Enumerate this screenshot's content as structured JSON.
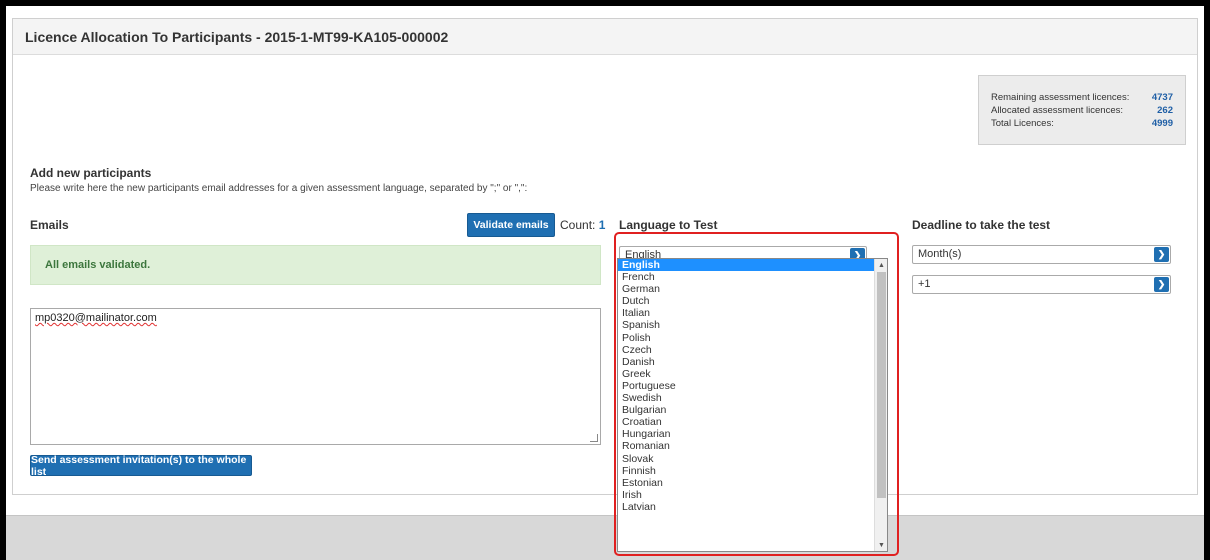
{
  "panel": {
    "title": "Licence Allocation To Participants - 2015-1-MT99-KA105-000002"
  },
  "stats": [
    {
      "label": "Remaining assessment licences:",
      "value": "4737"
    },
    {
      "label": "Allocated assessment licences:",
      "value": "262"
    },
    {
      "label": "Total Licences:",
      "value": "4999"
    }
  ],
  "add_section": {
    "title": "Add new participants",
    "description": "Please write here the new participants email addresses for a given assessment language, separated by \";\" or \",\":"
  },
  "emails": {
    "label": "Emails",
    "validate_button": "Validate emails",
    "count_label": "Count:",
    "count_value": "1",
    "alert": "All emails validated.",
    "textarea_value": "mp0320@mailinator.com",
    "send_button": "Send assessment invitation(s) to the whole list"
  },
  "language": {
    "label": "Language to Test",
    "selected": "English",
    "options": [
      "English",
      "French",
      "German",
      "Dutch",
      "Italian",
      "Spanish",
      "Polish",
      "Czech",
      "Danish",
      "Greek",
      "Portuguese",
      "Swedish",
      "Bulgarian",
      "Croatian",
      "Hungarian",
      "Romanian",
      "Slovak",
      "Finnish",
      "Estonian",
      "Irish",
      "Latvian"
    ]
  },
  "deadline": {
    "label": "Deadline to take the test",
    "unit_selected": "Month(s)",
    "amount_selected": "+1"
  },
  "colors": {
    "accent": "#1f6fb2",
    "alert_bg": "#dff0d8",
    "highlight": "#e02020",
    "selected_option": "#1e90ff"
  }
}
